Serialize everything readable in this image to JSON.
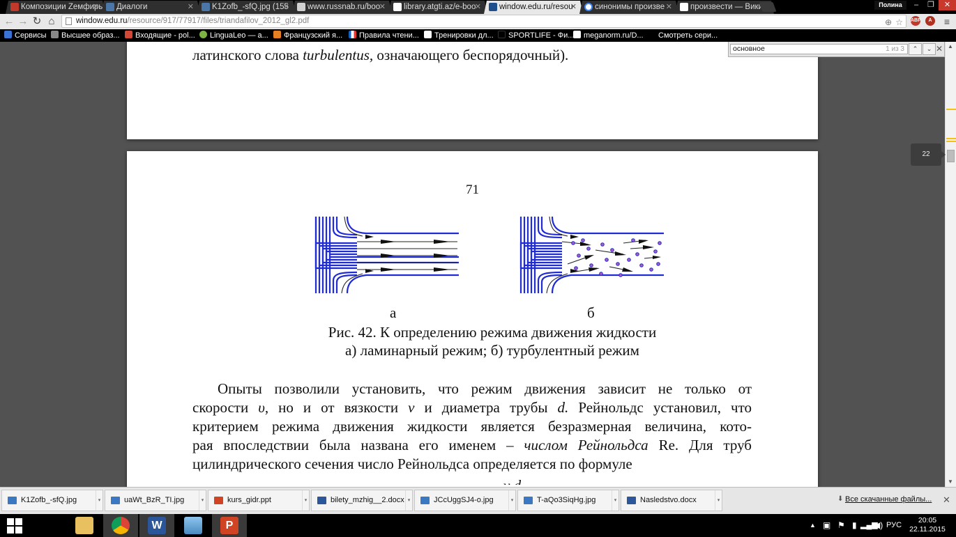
{
  "browser": {
    "tabs": [
      {
        "title": "Композиции Zeмфиры",
        "icon": "site-favicon",
        "color": "#c0392b"
      },
      {
        "title": "Диалоги",
        "icon": "vk-favicon",
        "color": "#4a76a8"
      },
      {
        "title": "K1Zofb_-sfQ.jpg (155",
        "icon": "vk-favicon",
        "color": "#4a76a8"
      },
      {
        "title": "www.russnab.ru/boo",
        "icon": "mail-favicon",
        "color": "#d0d0d0"
      },
      {
        "title": "library.atgti.az/e-boo",
        "icon": "page-favicon",
        "color": "#ffffff"
      },
      {
        "title": "window.edu.ru/resou",
        "icon": "book-favicon",
        "color": "#1f4e8c"
      },
      {
        "title": "синонимы произве",
        "icon": "google-favicon",
        "color": "#4285f4"
      },
      {
        "title": "произвести — Вики",
        "icon": "page-favicon",
        "color": "#ffffff"
      }
    ],
    "profile_name": "Полина",
    "url_host": "window.edu.ru",
    "url_path": "/resource/917/77917/files/triandafilov_2012_gl2.pdf",
    "extensions": [
      {
        "label": "ABP",
        "color": "#c0392b"
      },
      {
        "label": "A",
        "color": "#b03020"
      },
      {
        "label": "",
        "color": "#cc2222"
      }
    ]
  },
  "bookmarks": [
    {
      "label": "Сервисы",
      "color": "#3b73d4"
    },
    {
      "label": "Высшее образ...",
      "color": "#888888"
    },
    {
      "label": "Входящие - pol...",
      "color": "#d14836"
    },
    {
      "label": "LinguaLeo — а...",
      "color": "#7cb342"
    },
    {
      "label": "Французский я...",
      "color": "#e67e22"
    },
    {
      "label": "Правила чтени...",
      "color": "#1565c0"
    },
    {
      "label": "Тренировки дл...",
      "color": "#ffffff"
    },
    {
      "label": "SPORTLIFE - Фи...",
      "color": "#000000"
    },
    {
      "label": "meganorm.ru/D...",
      "color": "#ffffff"
    },
    {
      "label": "Смотреть сери...",
      "color": "#000000"
    }
  ],
  "find": {
    "query": "основное",
    "count": "1 из 3"
  },
  "document": {
    "prev_page_line1": "латинского слова ",
    "prev_page_italic": "turbulentus,",
    "prev_page_line1_end": " означающего беспорядочный).",
    "page_number": "71",
    "fig_label_a": "а",
    "fig_label_b": "б",
    "caption_line1": "Рис. 42. К определению режима движения жидкости",
    "caption_line2": "а) ламинарный режим; б) турбулентный режим",
    "para": {
      "l1": "Опыты позволили установить, что режим движения зависит не только от",
      "l2a": "скорости ",
      "l2v": "υ",
      "l2b": ", но и от вязкости ",
      "l2nu": "ν",
      "l2c": " и диаметра трубы ",
      "l2d": "d.",
      "l2e": " Рейнольдс установил, что",
      "l3": "критерием режима движения жидкости является безразмерная величина, кото-",
      "l4a": "рая впоследствии была названа его именем – ",
      "l4b": "числом Рейнольдса",
      "l4c": " Re. Для труб",
      "l5": "цилиндрического сечения число Рейнольдса определяется по формуле"
    },
    "current_page_badge": "22"
  },
  "figure": {
    "pipe_color": "#1f2bd4",
    "particle_color": "#b05dc0"
  },
  "downloads": [
    {
      "name": "K1Zofb_-sfQ.jpg",
      "icon": "image-file-icon",
      "color": "#3a78c2"
    },
    {
      "name": "uaWt_BzR_TI.jpg",
      "icon": "image-file-icon",
      "color": "#3a78c2"
    },
    {
      "name": "kurs_gidr.ppt",
      "icon": "powerpoint-file-icon",
      "color": "#d04423"
    },
    {
      "name": "bilety_mzhig__2.docx",
      "icon": "word-file-icon",
      "color": "#2b579a"
    },
    {
      "name": "JCcUggSJ4-o.jpg",
      "icon": "image-file-icon",
      "color": "#3a78c2"
    },
    {
      "name": "T-aQo3SiqHg.jpg",
      "icon": "image-file-icon",
      "color": "#3a78c2"
    },
    {
      "name": "Nasledstvo.docx",
      "icon": "word-file-icon",
      "color": "#2b579a"
    }
  ],
  "show_all_downloads": "Все скачанные файлы...",
  "taskbar": {
    "apps": [
      {
        "name": "windows-start-icon",
        "color": "#ffffff"
      },
      {
        "name": "photoshop-elements-icon",
        "color": "#e0a020"
      },
      {
        "name": "file-explorer-icon",
        "color": "#e8c060"
      },
      {
        "name": "chrome-icon",
        "color": "#db4437"
      },
      {
        "name": "word-icon",
        "color": "#2b579a"
      },
      {
        "name": "photo-viewer-icon",
        "color": "#5a9bd5"
      },
      {
        "name": "powerpoint-icon",
        "color": "#d04423"
      }
    ],
    "language": "РУС",
    "time": "20:05",
    "date": "22.11.2015"
  }
}
